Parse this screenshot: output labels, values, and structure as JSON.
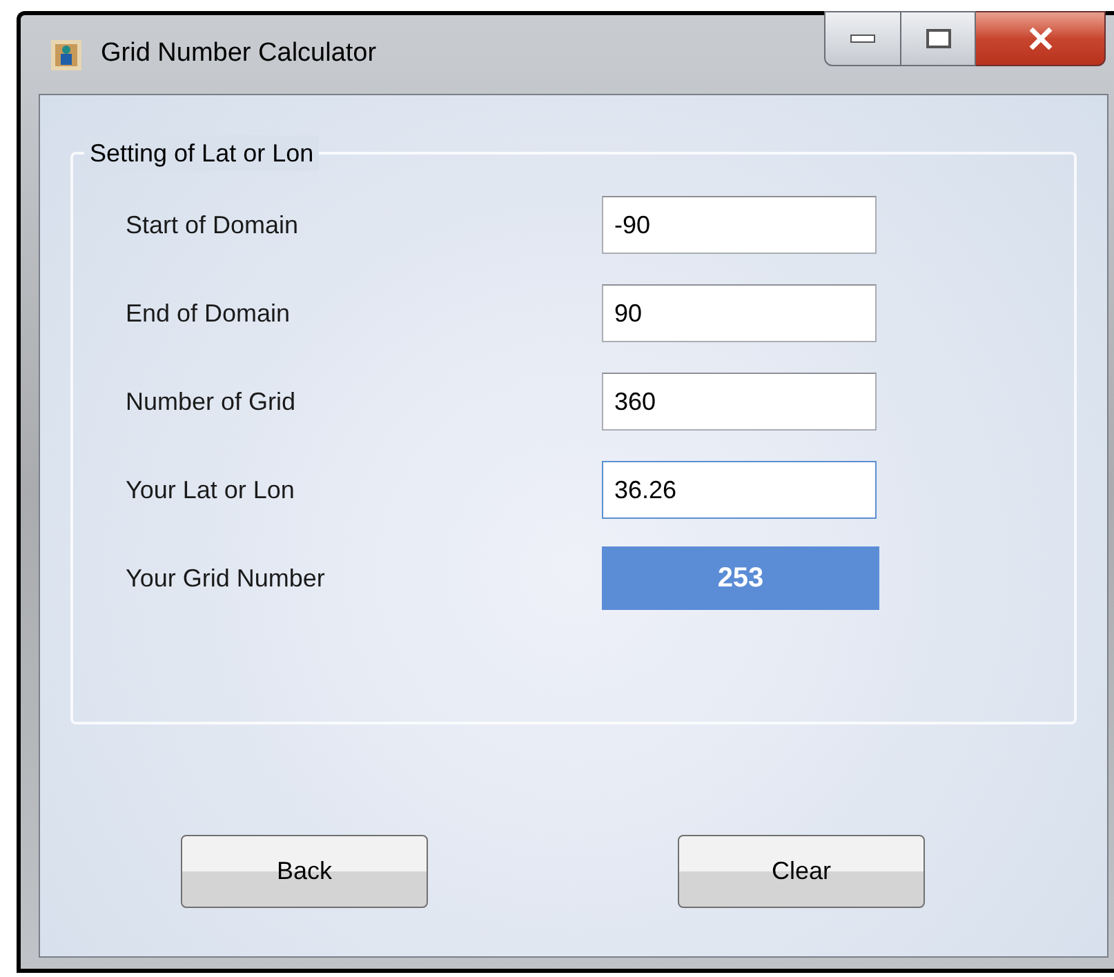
{
  "window": {
    "title": "Grid Number Calculator"
  },
  "group": {
    "title": "Setting of Lat or Lon"
  },
  "rows": [
    {
      "kind": "input",
      "label": "Start of Domain",
      "value": "-90",
      "focused": false
    },
    {
      "kind": "input",
      "label": "End of Domain",
      "value": "90",
      "focused": false
    },
    {
      "kind": "input",
      "label": "Number of Grid",
      "value": "360",
      "focused": false
    },
    {
      "kind": "input",
      "label": "Your Lat or Lon",
      "value": "36.26",
      "focused": true
    },
    {
      "kind": "output",
      "label": "Your Grid Number",
      "value": "253"
    }
  ],
  "buttons": [
    "Back",
    "Clear"
  ]
}
